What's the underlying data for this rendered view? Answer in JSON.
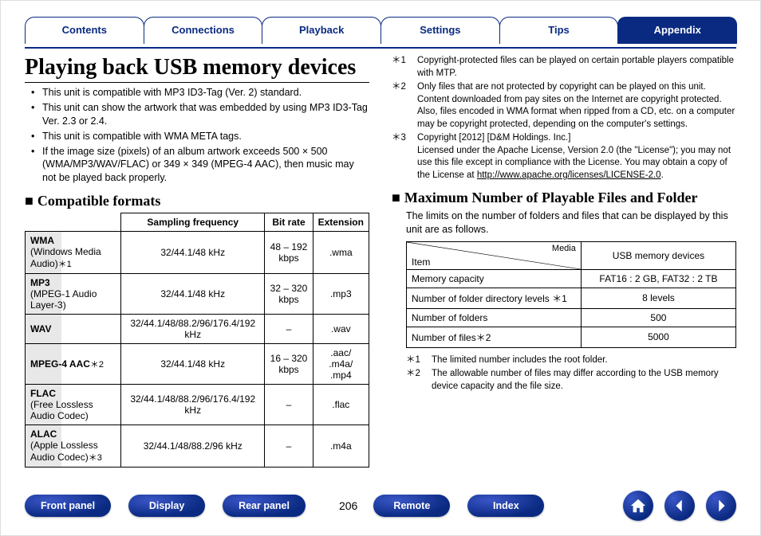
{
  "tabs": {
    "contents": "Contents",
    "connections": "Connections",
    "playback": "Playback",
    "settings": "Settings",
    "tips": "Tips",
    "appendix": "Appendix"
  },
  "title": "Playing back USB memory devices",
  "intro_bullets": [
    "This unit is compatible with MP3 ID3-Tag (Ver. 2) standard.",
    "This unit can show the artwork that was embedded by using MP3 ID3-Tag Ver. 2.3 or 2.4.",
    "This unit is compatible with WMA META tags.",
    "If the image size (pixels) of an album artwork exceeds 500 × 500 (WMA/MP3/WAV/FLAC) or 349 × 349 (MPEG-4 AAC), then music may not be played back properly."
  ],
  "section_compat": "Compatible formats",
  "fmt_headers": {
    "sf": "Sampling frequency",
    "br": "Bit rate",
    "ext": "Extension"
  },
  "fmt_rows": [
    {
      "name": "WMA",
      "sub": "(Windows Media Audio)",
      "mark": "＊1",
      "sf": "32/44.1/48 kHz",
      "br": "48 – 192 kbps",
      "ext": ".wma"
    },
    {
      "name": "MP3",
      "sub": "(MPEG-1 Audio Layer-3)",
      "mark": "",
      "sf": "32/44.1/48 kHz",
      "br": "32 – 320 kbps",
      "ext": ".mp3"
    },
    {
      "name": "WAV",
      "sub": "",
      "mark": "",
      "sf": "32/44.1/48/88.2/96/176.4/192 kHz",
      "br": "–",
      "ext": ".wav"
    },
    {
      "name": "MPEG-4 AAC",
      "sub": "",
      "mark": "＊2",
      "sf": "32/44.1/48 kHz",
      "br": "16 – 320 kbps",
      "ext": ".aac/\n.m4a/\n.mp4"
    },
    {
      "name": "FLAC",
      "sub": "(Free Lossless Audio Codec)",
      "mark": "",
      "sf": "32/44.1/48/88.2/96/176.4/192 kHz",
      "br": "–",
      "ext": ".flac"
    },
    {
      "name": "ALAC",
      "sub": "(Apple Lossless Audio Codec)",
      "mark": "＊3",
      "sf": "32/44.1/48/88.2/96 kHz",
      "br": "–",
      "ext": ".m4a"
    }
  ],
  "top_footnotes": [
    {
      "mark": "＊1",
      "text": "Copyright-protected files can be played on certain portable players compatible with MTP."
    },
    {
      "mark": "＊2",
      "text": "Only files that are not protected by copyright can be played on this unit. Content downloaded from pay sites on the Internet are copyright protected. Also, files encoded in WMA format when ripped from a CD, etc. on a computer may be copyright protected, depending on the computer's settings."
    },
    {
      "mark": "＊3",
      "text_pre": "Copyright [2012] [D&M Holdings. Inc.]\nLicensed under the Apache License, Version 2.0 (the \"License\"); you may not use this file except in compliance with the License. You may obtain a copy of the License at ",
      "link": "http://www.apache.org/licenses/LICENSE-2.0",
      "text_post": "."
    }
  ],
  "section_max": "Maximum Number of Playable Files and Folder",
  "max_intro": "The limits on the number of folders and files that can be displayed by this unit are as follows.",
  "limits_header": {
    "media": "Media",
    "item": "Item",
    "val": "USB memory devices"
  },
  "limits_rows": [
    {
      "item": "Memory capacity",
      "val": "FAT16 : 2 GB, FAT32 : 2 TB"
    },
    {
      "item": "Number of folder directory levels ＊1",
      "val": "8 levels"
    },
    {
      "item": "Number of folders",
      "val": "500"
    },
    {
      "item": "Number of files＊2",
      "val": "5000"
    }
  ],
  "limits_footnotes": [
    {
      "mark": "＊1",
      "text": "The limited number includes the root folder."
    },
    {
      "mark": "＊2",
      "text": "The allowable number of files may differ according to the USB memory device capacity and the file size."
    }
  ],
  "bottom": {
    "front_panel": "Front panel",
    "display": "Display",
    "rear_panel": "Rear panel",
    "page": "206",
    "remote": "Remote",
    "index": "Index"
  }
}
